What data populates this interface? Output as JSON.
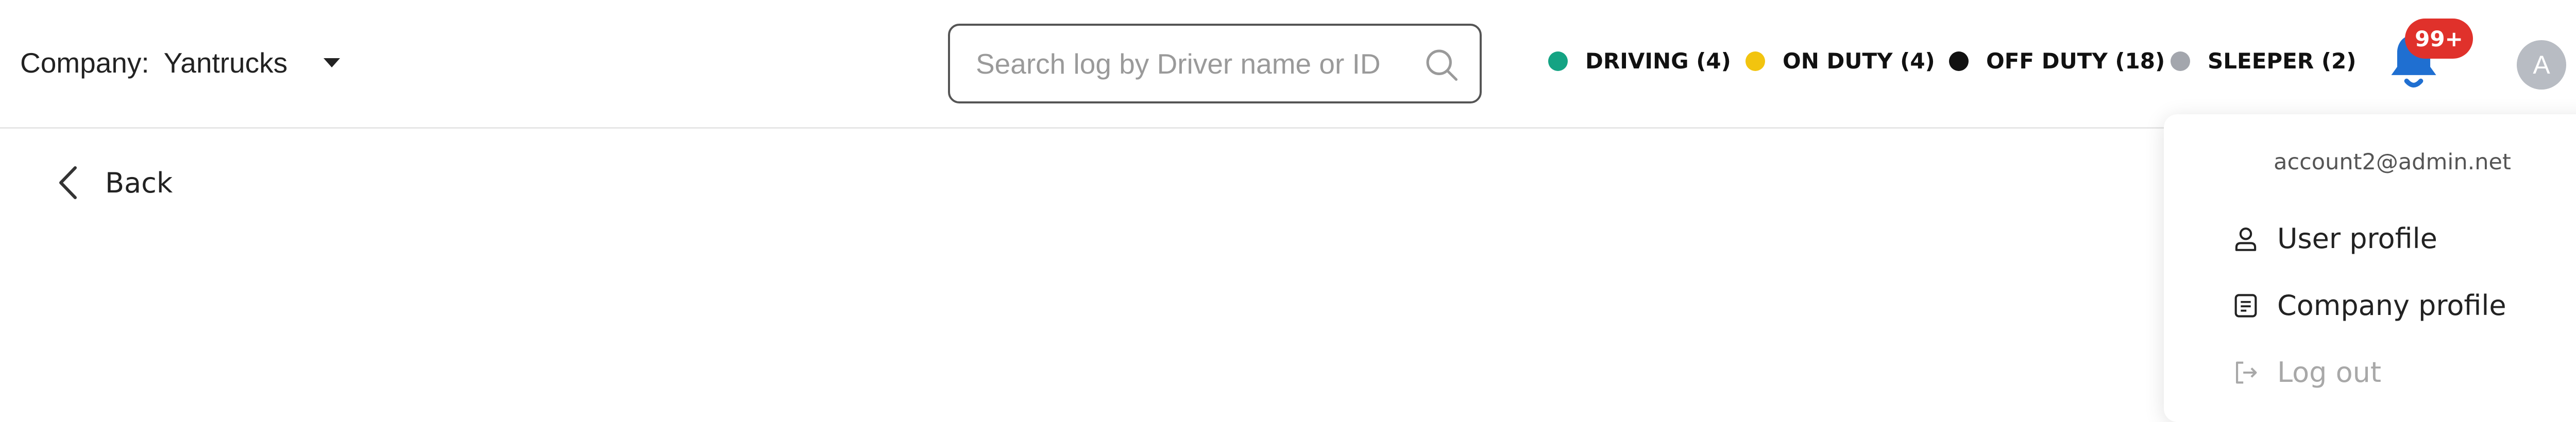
{
  "header": {
    "company_label": "Company:",
    "company_name": "Yantrucks",
    "search_placeholder": "Search log by Driver name or ID",
    "statuses": [
      {
        "label": "DRIVING (4)",
        "color": "#14a383"
      },
      {
        "label": "ON DUTY (4)",
        "color": "#f2c40f"
      },
      {
        "label": "OFF DUTY (18)",
        "color": "#111111"
      },
      {
        "label": "SLEEPER (2)",
        "color": "#a3a6ad"
      }
    ],
    "notifications_badge": "99+",
    "avatar_initial": "A"
  },
  "back_label": "Back",
  "account_menu": {
    "email": "account2@admin.net",
    "items": [
      {
        "label": "User profile",
        "icon": "user-icon",
        "enabled": true
      },
      {
        "label": "Company profile",
        "icon": "document-icon",
        "enabled": true
      },
      {
        "label": "Log out",
        "icon": "logout-icon",
        "enabled": false
      }
    ]
  },
  "colors": {
    "bell": "#1f6fd1",
    "badge": "#e0312b",
    "avatar": "#b8bcc3"
  }
}
